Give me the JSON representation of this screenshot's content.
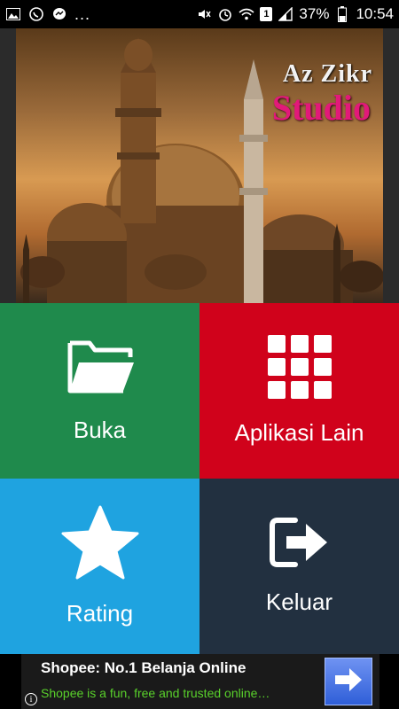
{
  "status_bar": {
    "left_icons": [
      "image-icon",
      "whatsapp-icon",
      "messenger-icon"
    ],
    "overflow": "...",
    "sim_badge": "1",
    "battery_percent": "37%",
    "clock": "10:54"
  },
  "banner": {
    "brand_line1": "Az Zikr",
    "brand_line2": "Studio",
    "colors": {
      "brand_pink": "#e2197a"
    }
  },
  "tiles": [
    {
      "label": "Buka",
      "icon": "folder-icon",
      "color": "#1f8a4c"
    },
    {
      "label": "Aplikasi Lain",
      "icon": "grid-icon",
      "color": "#d0021b"
    },
    {
      "label": "Rating",
      "icon": "star-icon",
      "color": "#1fa3e0"
    },
    {
      "label": "Keluar",
      "icon": "exit-icon",
      "color": "#223040"
    }
  ],
  "ad": {
    "title": "Shopee: No.1 Belanja Online",
    "subtitle": "Shopee is a fun, free and trusted online…",
    "info": "i",
    "subtitle_color": "#59d12b"
  }
}
